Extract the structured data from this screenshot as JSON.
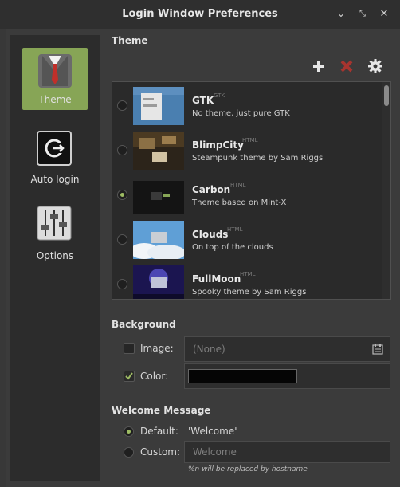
{
  "window": {
    "title": "Login Window Preferences"
  },
  "sidebar": {
    "items": [
      {
        "label": "Theme",
        "icon": "suit-icon"
      },
      {
        "label": "Auto login",
        "icon": "power-icon"
      },
      {
        "label": "Options",
        "icon": "sliders-icon"
      }
    ]
  },
  "theme": {
    "heading": "Theme",
    "toolbar": {
      "add": "add-icon",
      "remove": "remove-icon",
      "settings": "gear-icon"
    },
    "items": [
      {
        "name": "GTK",
        "type": "GTK",
        "desc": "No theme, just pure GTK",
        "selected": false
      },
      {
        "name": "BlimpCity",
        "type": "HTML",
        "desc": "Steampunk theme by Sam Riggs",
        "selected": false
      },
      {
        "name": "Carbon",
        "type": "HTML",
        "desc": "Theme based on Mint-X",
        "selected": true
      },
      {
        "name": "Clouds",
        "type": "HTML",
        "desc": "On top of the clouds",
        "selected": false
      },
      {
        "name": "FullMoon",
        "type": "HTML",
        "desc": "Spooky theme by Sam Riggs",
        "selected": false
      }
    ]
  },
  "background": {
    "heading": "Background",
    "image_label": "Image:",
    "image_placeholder": "(None)",
    "image_checked": false,
    "color_label": "Color:",
    "color_checked": true,
    "color_value": "#050505"
  },
  "welcome": {
    "heading": "Welcome Message",
    "default_label": "Default:",
    "default_value": "'Welcome'",
    "custom_label": "Custom:",
    "custom_placeholder": "Welcome",
    "hint": "%n will be replaced by hostname"
  },
  "colors": {
    "accent": "#87a556",
    "radio_dot": "#9dbb63"
  }
}
